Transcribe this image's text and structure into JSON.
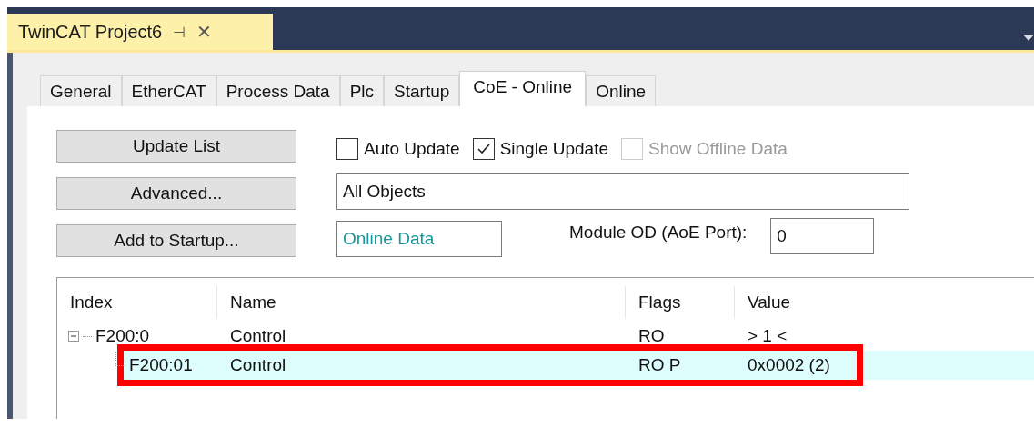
{
  "document_tab": {
    "title": "TwinCAT Project6",
    "pin": "⊣",
    "close": "✕"
  },
  "tabs": [
    {
      "label": "General",
      "selected": false
    },
    {
      "label": "EtherCAT",
      "selected": false
    },
    {
      "label": "Process Data",
      "selected": false
    },
    {
      "label": "Plc",
      "selected": false
    },
    {
      "label": "Startup",
      "selected": false
    },
    {
      "label": "CoE - Online",
      "selected": true
    },
    {
      "label": "Online",
      "selected": false
    }
  ],
  "buttons": [
    "Update List",
    "Advanced...",
    "Add to Startup..."
  ],
  "checkboxes": [
    {
      "label": "Auto Update",
      "checked": false,
      "disabled": false
    },
    {
      "label": "Single Update",
      "checked": true,
      "disabled": false
    },
    {
      "label": "Show Offline Data",
      "checked": false,
      "disabled": true
    }
  ],
  "object_filter": {
    "value": "All Objects"
  },
  "data_source": {
    "value": "Online Data"
  },
  "module_od": {
    "label": "Module OD (AoE Port):",
    "value": "0"
  },
  "table": {
    "columns": [
      "Index",
      "Name",
      "Flags",
      "Value"
    ],
    "rows": [
      {
        "index": "F200:0",
        "name": "Control",
        "flags": "RO",
        "value": "> 1 <",
        "expanded": true,
        "selected": false,
        "annotated": false,
        "children": [
          {
            "index": "F200:01",
            "name": "Control",
            "flags": "RO P",
            "value": "0x0002 (2)",
            "selected": true,
            "annotated": true
          }
        ]
      }
    ]
  }
}
